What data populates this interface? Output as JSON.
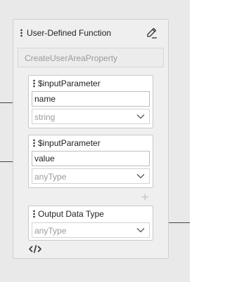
{
  "node": {
    "title": "User-Defined Function",
    "function_name_placeholder": "CreateUserAreaProperty",
    "parameters": [
      {
        "label": "$inputParameter",
        "name_value": "name",
        "type_value": "string"
      },
      {
        "label": "$inputParameter",
        "name_value": "value",
        "type_value": "anyType"
      }
    ],
    "output": {
      "label": "Output Data Type",
      "type_value": "anyType"
    },
    "add_symbol": "+",
    "icons": {
      "edit": "pencil-icon",
      "code": "code-icon",
      "drag": "drag-handle-icon",
      "add": "plus-icon",
      "chevron": "chevron-down-icon",
      "input_port": "arrow-right-icon",
      "output_port": "arrow-right-icon"
    }
  },
  "colors": {
    "canvas": "#e9e9e9",
    "node_bg": "#efefef",
    "panel_bg": "#ffffff",
    "text": "#222222",
    "muted_text": "#9a9a9a",
    "port": "#333333"
  }
}
